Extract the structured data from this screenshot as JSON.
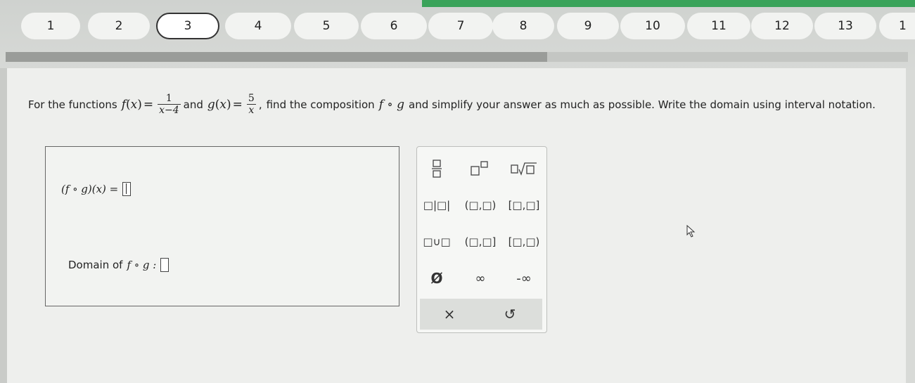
{
  "nav": {
    "questions": [
      "1",
      "2",
      "3",
      "4",
      "5",
      "6",
      "7",
      "8",
      "9",
      "10",
      "11",
      "12",
      "13",
      "1"
    ],
    "current_index": 2,
    "progress": 0.6
  },
  "question": {
    "intro": "For the functions",
    "f_name": "f",
    "g_name": "g",
    "var": "x",
    "f_num": "1",
    "f_den": "x−4",
    "g_num": "5",
    "g_den": "x",
    "and": "and",
    "find": "find the composition",
    "comp": "f ∘ g",
    "rest": "and simplify your answer as much as possible. Write the domain using interval notation."
  },
  "answer": {
    "composition_label": "(f ∘ g)(x) =",
    "domain_label": "Domain of",
    "domain_fn": "f ∘ g :"
  },
  "palette": {
    "fraction": "□/□",
    "superscript": "□ⁿ",
    "nth_root": "□√□",
    "abs": "□|□|",
    "open_interval": "(□,□)",
    "closed_interval": "[□,□]",
    "union": "□∪□",
    "half_open_right": "(□,□]",
    "half_open_left": "[□,□)",
    "empty_set": "Ø",
    "infinity": "∞",
    "neg_infinity": "-∞",
    "clear": "×",
    "undo": "↺"
  }
}
